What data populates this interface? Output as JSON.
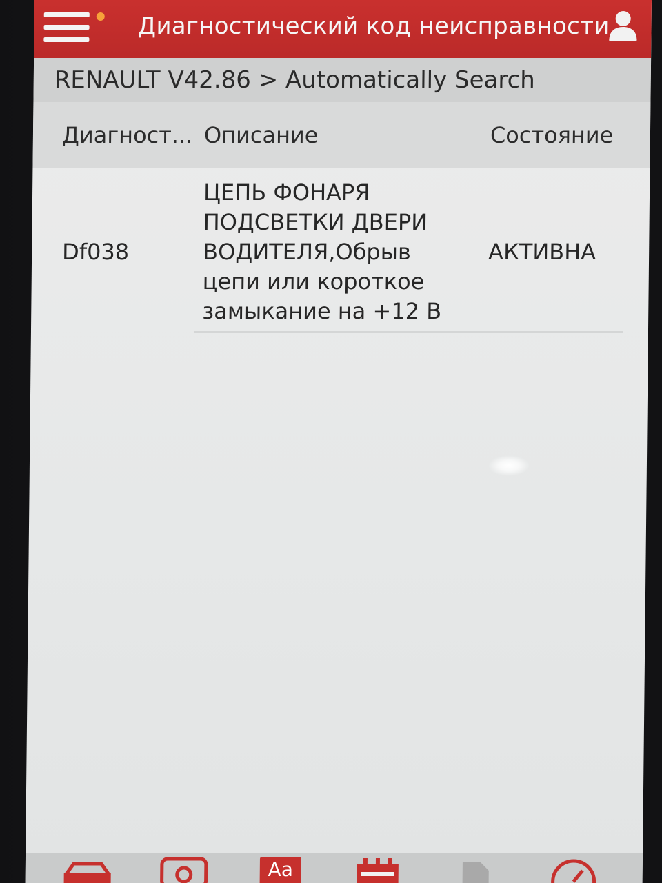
{
  "header": {
    "title": "Диагностический код неисправности",
    "menu_icon": "hamburger-menu-icon",
    "user_icon": "user-icon",
    "colors": {
      "bar": "#c9302e",
      "text": "#f6f6f6",
      "dot": "#f7a13a"
    }
  },
  "breadcrumb": {
    "text": "RENAULT V42.86 > Automatically Search"
  },
  "table": {
    "columns": [
      "Диагност...",
      "Описание",
      "Состояние"
    ],
    "rows": [
      {
        "code": "Df038",
        "description": "ЦЕПЬ ФОНАРЯ ПОДСВЕТКИ ДВЕРИ ВОДИТЕЛЯ,Обрыв цепи или короткое замыкание на +12 В",
        "state": "АКТИВНА"
      }
    ]
  },
  "toolbar": {
    "items": [
      {
        "icon": "car-icon"
      },
      {
        "icon": "search-icon"
      },
      {
        "icon": "font-size-icon",
        "label": "Aa"
      },
      {
        "icon": "calendar-icon"
      },
      {
        "icon": "document-icon"
      },
      {
        "icon": "gauge-icon"
      }
    ],
    "accent": "#c6302d"
  }
}
